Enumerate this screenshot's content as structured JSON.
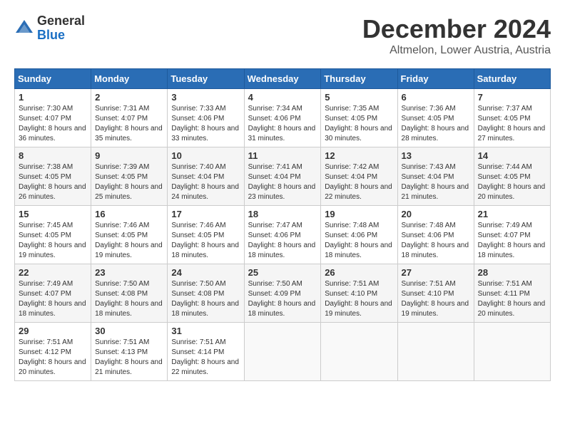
{
  "logo": {
    "general": "General",
    "blue": "Blue"
  },
  "title": "December 2024",
  "location": "Altmelon, Lower Austria, Austria",
  "headers": [
    "Sunday",
    "Monday",
    "Tuesday",
    "Wednesday",
    "Thursday",
    "Friday",
    "Saturday"
  ],
  "weeks": [
    [
      {
        "day": "1",
        "info": "Sunrise: 7:30 AM\nSunset: 4:07 PM\nDaylight: 8 hours and 36 minutes."
      },
      {
        "day": "2",
        "info": "Sunrise: 7:31 AM\nSunset: 4:07 PM\nDaylight: 8 hours and 35 minutes."
      },
      {
        "day": "3",
        "info": "Sunrise: 7:33 AM\nSunset: 4:06 PM\nDaylight: 8 hours and 33 minutes."
      },
      {
        "day": "4",
        "info": "Sunrise: 7:34 AM\nSunset: 4:06 PM\nDaylight: 8 hours and 31 minutes."
      },
      {
        "day": "5",
        "info": "Sunrise: 7:35 AM\nSunset: 4:05 PM\nDaylight: 8 hours and 30 minutes."
      },
      {
        "day": "6",
        "info": "Sunrise: 7:36 AM\nSunset: 4:05 PM\nDaylight: 8 hours and 28 minutes."
      },
      {
        "day": "7",
        "info": "Sunrise: 7:37 AM\nSunset: 4:05 PM\nDaylight: 8 hours and 27 minutes."
      }
    ],
    [
      {
        "day": "8",
        "info": "Sunrise: 7:38 AM\nSunset: 4:05 PM\nDaylight: 8 hours and 26 minutes."
      },
      {
        "day": "9",
        "info": "Sunrise: 7:39 AM\nSunset: 4:05 PM\nDaylight: 8 hours and 25 minutes."
      },
      {
        "day": "10",
        "info": "Sunrise: 7:40 AM\nSunset: 4:04 PM\nDaylight: 8 hours and 24 minutes."
      },
      {
        "day": "11",
        "info": "Sunrise: 7:41 AM\nSunset: 4:04 PM\nDaylight: 8 hours and 23 minutes."
      },
      {
        "day": "12",
        "info": "Sunrise: 7:42 AM\nSunset: 4:04 PM\nDaylight: 8 hours and 22 minutes."
      },
      {
        "day": "13",
        "info": "Sunrise: 7:43 AM\nSunset: 4:04 PM\nDaylight: 8 hours and 21 minutes."
      },
      {
        "day": "14",
        "info": "Sunrise: 7:44 AM\nSunset: 4:05 PM\nDaylight: 8 hours and 20 minutes."
      }
    ],
    [
      {
        "day": "15",
        "info": "Sunrise: 7:45 AM\nSunset: 4:05 PM\nDaylight: 8 hours and 19 minutes."
      },
      {
        "day": "16",
        "info": "Sunrise: 7:46 AM\nSunset: 4:05 PM\nDaylight: 8 hours and 19 minutes."
      },
      {
        "day": "17",
        "info": "Sunrise: 7:46 AM\nSunset: 4:05 PM\nDaylight: 8 hours and 18 minutes."
      },
      {
        "day": "18",
        "info": "Sunrise: 7:47 AM\nSunset: 4:06 PM\nDaylight: 8 hours and 18 minutes."
      },
      {
        "day": "19",
        "info": "Sunrise: 7:48 AM\nSunset: 4:06 PM\nDaylight: 8 hours and 18 minutes."
      },
      {
        "day": "20",
        "info": "Sunrise: 7:48 AM\nSunset: 4:06 PM\nDaylight: 8 hours and 18 minutes."
      },
      {
        "day": "21",
        "info": "Sunrise: 7:49 AM\nSunset: 4:07 PM\nDaylight: 8 hours and 18 minutes."
      }
    ],
    [
      {
        "day": "22",
        "info": "Sunrise: 7:49 AM\nSunset: 4:07 PM\nDaylight: 8 hours and 18 minutes."
      },
      {
        "day": "23",
        "info": "Sunrise: 7:50 AM\nSunset: 4:08 PM\nDaylight: 8 hours and 18 minutes."
      },
      {
        "day": "24",
        "info": "Sunrise: 7:50 AM\nSunset: 4:08 PM\nDaylight: 8 hours and 18 minutes."
      },
      {
        "day": "25",
        "info": "Sunrise: 7:50 AM\nSunset: 4:09 PM\nDaylight: 8 hours and 18 minutes."
      },
      {
        "day": "26",
        "info": "Sunrise: 7:51 AM\nSunset: 4:10 PM\nDaylight: 8 hours and 19 minutes."
      },
      {
        "day": "27",
        "info": "Sunrise: 7:51 AM\nSunset: 4:10 PM\nDaylight: 8 hours and 19 minutes."
      },
      {
        "day": "28",
        "info": "Sunrise: 7:51 AM\nSunset: 4:11 PM\nDaylight: 8 hours and 20 minutes."
      }
    ],
    [
      {
        "day": "29",
        "info": "Sunrise: 7:51 AM\nSunset: 4:12 PM\nDaylight: 8 hours and 20 minutes."
      },
      {
        "day": "30",
        "info": "Sunrise: 7:51 AM\nSunset: 4:13 PM\nDaylight: 8 hours and 21 minutes."
      },
      {
        "day": "31",
        "info": "Sunrise: 7:51 AM\nSunset: 4:14 PM\nDaylight: 8 hours and 22 minutes."
      },
      {
        "day": "",
        "info": ""
      },
      {
        "day": "",
        "info": ""
      },
      {
        "day": "",
        "info": ""
      },
      {
        "day": "",
        "info": ""
      }
    ]
  ]
}
